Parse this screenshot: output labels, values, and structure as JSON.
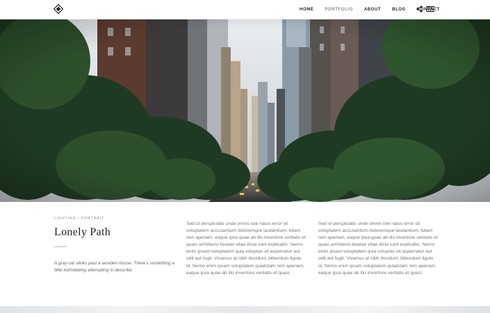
{
  "nav": {
    "items": [
      "HOME",
      "PORTFOLIO",
      "ABOUT",
      "BLOG",
      "CONTACT"
    ]
  },
  "colors": {
    "text": "#222222",
    "muted": "#888888",
    "body": "#777777"
  },
  "icons": {
    "logo": "diamond-logo-icon",
    "share": "share-icon",
    "menu": "hamburger-menu-icon"
  },
  "hero": {
    "image": "city-street-with-trees"
  },
  "post": {
    "category": "LIGHTING / PORTRAIT",
    "title": "Lonely Path",
    "description": "A gray cat slinks past a wooden house. There's something a little intimidating attempting to describe",
    "column1": "Sed ut perspiciatis unde omnis iste natus error sit voluptatem accusantium doloremque laudantium, totam rem aperiam, eaque ipsa quae ab illo inventore veritatis et quasi architecto beatae vitae dicta sunt explicabo. Nemo enim ipsam voluptatem quia voluptas sit aspernatur aut odit aut fugit. Vivamus at nibh tincidunt, bibendum ligula id. Nemo enim ipsam voluptatem quiatotam rem aperiam, eaque ipsa quae ab illo inventore veritatis et quasi.",
    "column2": "Sed ut perspiciatis unde omnis iste natus error sit voluptatem accusantium doloremque laudantium, totam rem aperiam, eaque ipsa quae ab illo inventore veritatis et quasi architecto beatae vitae dicta sunt explicabo. Nemo enim ipsam voluptatem quia voluptas sit aspernatur aut odit aut fugit. Vivamus at nibh tincidunt, bibendum ligula id. Nemo enim ipsam voluptatem quiatotam rem aperiam, eaque ipsa quae ab illo inventore veritatis et quasi."
  }
}
